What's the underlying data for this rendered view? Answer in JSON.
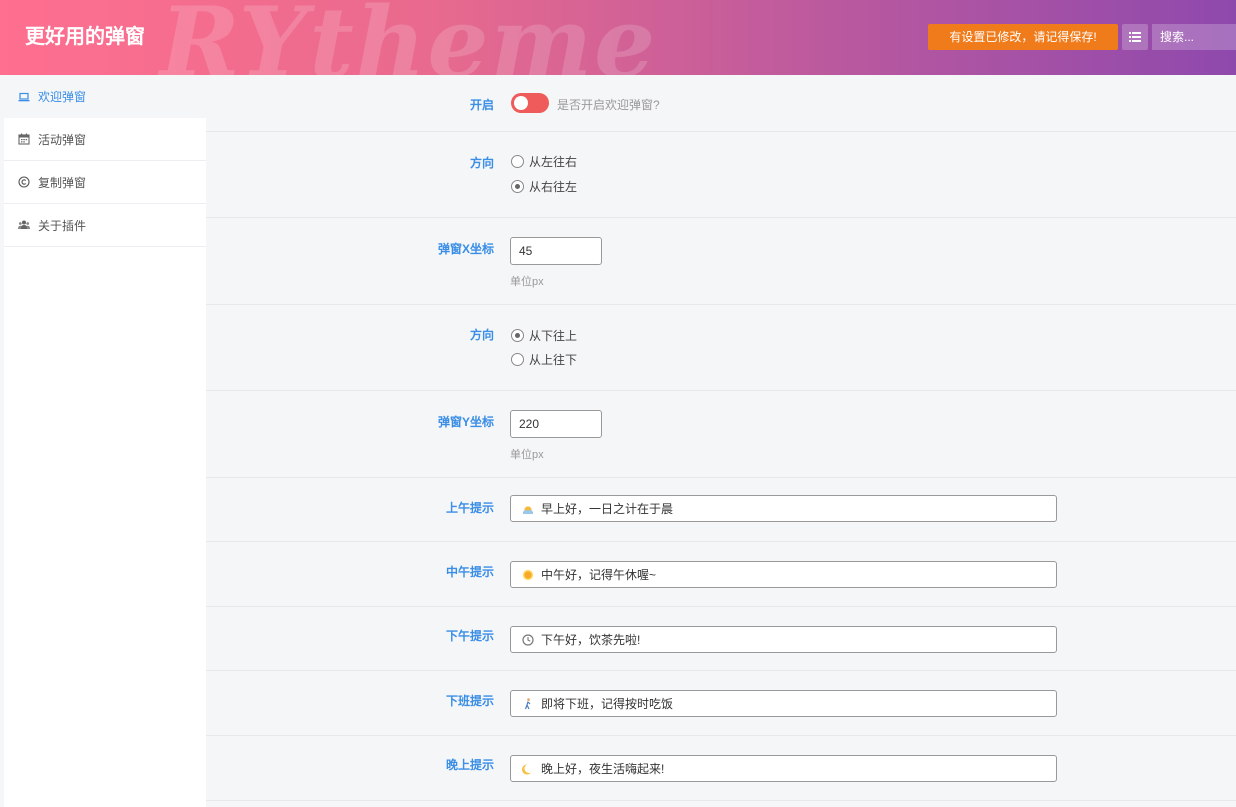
{
  "header": {
    "title": "更好用的弹窗",
    "watermark": "RYtheme",
    "notice_button": "有设置已修改，请记得保存!",
    "list_icon": "list-icon",
    "search_placeholder": "搜索..."
  },
  "sidebar": {
    "items": [
      {
        "label": "欢迎弹窗",
        "icon": "laptop-icon"
      },
      {
        "label": "活动弹窗",
        "icon": "calendar-icon"
      },
      {
        "label": "复制弹窗",
        "icon": "copyright-icon"
      },
      {
        "label": "关于插件",
        "icon": "users-icon"
      }
    ]
  },
  "form": {
    "enable": {
      "label": "开启",
      "hint": "是否开启欢迎弹窗?",
      "value": "on"
    },
    "direction_x": {
      "label": "方向",
      "options": [
        "从左往右",
        "从右往左"
      ],
      "selected": "从右往左"
    },
    "pos_x": {
      "label": "弹窗X坐标",
      "value": "45",
      "unit": "单位px"
    },
    "direction_y": {
      "label": "方向",
      "options": [
        "从下往上",
        "从上往下"
      ],
      "selected": "从下往上"
    },
    "pos_y": {
      "label": "弹窗Y坐标",
      "value": "220",
      "unit": "单位px"
    },
    "morning": {
      "label": "上午提示",
      "value": "早上好，一日之计在于晨",
      "icon": "sunrise-icon"
    },
    "noon": {
      "label": "中午提示",
      "value": "中午好，记得午休喔~",
      "icon": "sun-icon"
    },
    "afternoon": {
      "label": "下午提示",
      "value": "下午好，饮茶先啦!",
      "icon": "clock-icon"
    },
    "offwork": {
      "label": "下班提示",
      "value": "即将下班，记得按时吃饭",
      "icon": "walking-icon"
    },
    "evening": {
      "label": "晚上提示",
      "value": "晚上好，夜生活嗨起来!",
      "icon": "moon-icon"
    }
  },
  "colors": {
    "accent": "#3a8ee6",
    "notice": "#f07b1b",
    "toggle_on": "#ef5b5b",
    "header_start": "#ff6f8f",
    "header_end": "#8e49ad"
  }
}
